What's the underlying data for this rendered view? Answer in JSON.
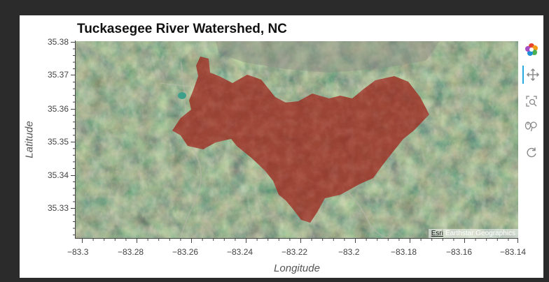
{
  "map": {
    "title": "Tuckasegee River Watershed, NC",
    "xlabel": "Longitude",
    "ylabel": "Latitude",
    "x_ticks": [
      "−83.3",
      "−83.28",
      "−83.26",
      "−83.24",
      "−83.22",
      "−83.2",
      "−83.18",
      "−83.16",
      "−83.14"
    ],
    "y_ticks": [
      "35.38",
      "35.37",
      "35.36",
      "35.35",
      "35.34",
      "35.33"
    ],
    "basemap": "satellite imagery",
    "watershed_color": "#9b2d22",
    "attribution": {
      "link": "Esri",
      "text": "Earthstar Geographics"
    }
  },
  "toolbar": {
    "logo": "bokeh-logo-icon",
    "tools": [
      "pan-icon",
      "box-zoom-icon",
      "wheel-zoom-icon",
      "reset-icon"
    ]
  }
}
